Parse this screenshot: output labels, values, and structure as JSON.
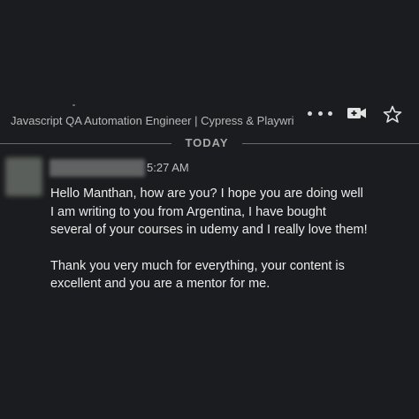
{
  "conversation": {
    "subtitle": "Javascript QA Automation Engineer | Cypress & Playwri"
  },
  "icons": {
    "more": "more-horizontal-icon",
    "video": "video-icon",
    "star": "star-outline-icon"
  },
  "divider": {
    "label": "TODAY"
  },
  "message": {
    "author_name": "",
    "timestamp": "5:27 AM",
    "paragraphs": [
      "Hello Manthan, how are you? I hope you are doing well I am writing to you from Argentina, I have bought several of your courses in udemy and I really love them!",
      "Thank you very much for everything, your content is excellent and you are a mentor for me."
    ]
  },
  "colors": {
    "background": "#1b1c1f",
    "text": "#ececec",
    "muted": "#a8a8a8"
  }
}
